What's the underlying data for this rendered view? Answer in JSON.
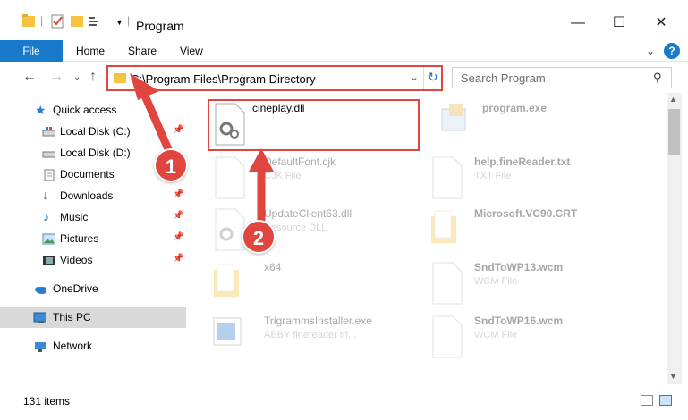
{
  "window": {
    "title": "Program"
  },
  "ribbon": {
    "file": "File",
    "tabs": [
      "Home",
      "Share",
      "View"
    ]
  },
  "address": {
    "path": "C:\\Program Files\\Program Directory"
  },
  "search": {
    "placeholder": "Search Program"
  },
  "sidebar": {
    "items": [
      {
        "label": "Quick access",
        "icon": "star-icon"
      },
      {
        "label": "Local Disk (C:)",
        "icon": "drive-icon",
        "pinned": true
      },
      {
        "label": "Local Disk (D:)",
        "icon": "drive-icon"
      },
      {
        "label": "Documents",
        "icon": "documents-icon"
      },
      {
        "label": "Downloads",
        "icon": "download-icon",
        "pinned": true
      },
      {
        "label": "Music",
        "icon": "music-icon",
        "pinned": true
      },
      {
        "label": "Pictures",
        "icon": "pictures-icon",
        "pinned": true
      },
      {
        "label": "Videos",
        "icon": "videos-icon",
        "pinned": true
      },
      {
        "label": "OneDrive",
        "icon": "cloud-icon"
      },
      {
        "label": "This PC",
        "icon": "computer-icon",
        "selected": true
      },
      {
        "label": "Network",
        "icon": "network-icon"
      }
    ]
  },
  "files": [
    {
      "name": "cineplay.dll",
      "type": ""
    },
    {
      "name": "program.exe",
      "type": ""
    },
    {
      "name": "DefaultFont.cjk",
      "type": "CJK File"
    },
    {
      "name": "help.fineReader.txt",
      "type": "TXT File"
    },
    {
      "name": "UpdateClient63.dll",
      "type": "Resource DLL"
    },
    {
      "name": "Microsoft.VC90.CRT",
      "type": ""
    },
    {
      "name": "x64",
      "type": ""
    },
    {
      "name": "SndToWP13.wcm",
      "type": "WCM File"
    },
    {
      "name": "TrigrammsInstaller.exe",
      "type": "ABBY finereader tri..."
    },
    {
      "name": "SndToWP16.wcm",
      "type": "WCM File"
    }
  ],
  "status": {
    "count": "131 items"
  },
  "callouts": {
    "one": "1",
    "two": "2"
  },
  "colors": {
    "accent": "#1979ca",
    "highlight": "#e0463f",
    "folder": "#f5c342"
  }
}
